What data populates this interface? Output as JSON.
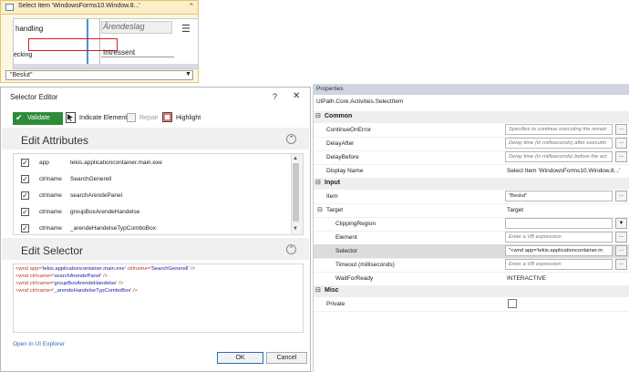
{
  "activity": {
    "title": "Select Item 'WindowsForms10.Window.8...'",
    "screenshot": {
      "left_label": "handling",
      "left_label2": "ecking",
      "header": "Ärendeslag",
      "value": "Intressent"
    },
    "combo_value": "\"Beslut\""
  },
  "dialog": {
    "title": "Selector Editor",
    "help": "?",
    "close": "✕",
    "toolbar": {
      "validate": "Validate",
      "indicate": "Indicate Element",
      "repair": "Repair",
      "highlight": "Highlight"
    },
    "edit_attributes": {
      "title": "Edit Attributes",
      "rows": [
        {
          "checked": true,
          "name": "app",
          "value": "tekis.applicationcontainer.main.exe"
        },
        {
          "checked": true,
          "name": "ctrlname",
          "value": "SearchGenerell"
        },
        {
          "checked": true,
          "name": "ctrlname",
          "value": "searchArendePanel"
        },
        {
          "checked": true,
          "name": "ctrlname",
          "value": "groupBoxArendeHandelse"
        },
        {
          "checked": true,
          "name": "ctrlname",
          "value": "_arendeHandelseTypComboBox"
        }
      ]
    },
    "edit_selector": {
      "title": "Edit Selector",
      "lines": [
        {
          "tag": "<wnd",
          "attr1": " app=",
          "val1": "'tekis.applicationcontainer.main.exe'",
          "attr2": " ctrlname=",
          "val2": "'SearchGenerell'",
          "end": " />"
        },
        {
          "tag": "<wnd",
          "attr1": " ctrlname=",
          "val1": "'searchArendePanel'",
          "attr2": "",
          "val2": "",
          "end": " />"
        },
        {
          "tag": "<wnd",
          "attr1": " ctrlname=",
          "val1": "'groupBoxArendeHandelse'",
          "attr2": "",
          "val2": "",
          "end": " />"
        },
        {
          "tag": "<wnd",
          "attr1": " ctrlname=",
          "val1": "'_arendeHandelseTypComboBox'",
          "attr2": "",
          "val2": "",
          "end": " />"
        }
      ]
    },
    "open_in_ui_explorer": "Open in UI Explorer",
    "ok": "OK",
    "cancel": "Cancel"
  },
  "properties": {
    "tab_label": "Properties",
    "class_name": "UiPath.Core.Activities.SelectItem",
    "common": {
      "label": "Common",
      "continue_on_error": {
        "name": "ContinueOnError",
        "placeholder": "Specifies to continue executing the remair"
      },
      "delay_after": {
        "name": "DelayAfter",
        "placeholder": "Delay time (in milliseconds) after executin"
      },
      "delay_before": {
        "name": "DelayBefore",
        "placeholder": "Delay time (in milliseconds) before the act"
      },
      "display_name": {
        "name": "Display Name",
        "value": "Select Item 'WindowsForms10.Window.8...'"
      }
    },
    "input": {
      "label": "Input",
      "item": {
        "name": "Item",
        "value": "\"Beslut\""
      },
      "target": {
        "name": "Target",
        "value": "Target"
      },
      "clipping_region": {
        "name": "ClippingRegion",
        "value": ""
      },
      "element": {
        "name": "Element",
        "placeholder": "Enter a VB expression"
      },
      "selector": {
        "name": "Selector",
        "value": "\"<wnd app='tekis.applicationcontainer.m"
      },
      "timeout": {
        "name": "Timeout (milliseconds)",
        "placeholder": "Enter a VB expression"
      },
      "wait_for_ready": {
        "name": "WaitForReady",
        "value": "INTERACTIVE"
      }
    },
    "misc": {
      "label": "Misc",
      "private": {
        "name": "Private"
      }
    },
    "dots": "..."
  }
}
